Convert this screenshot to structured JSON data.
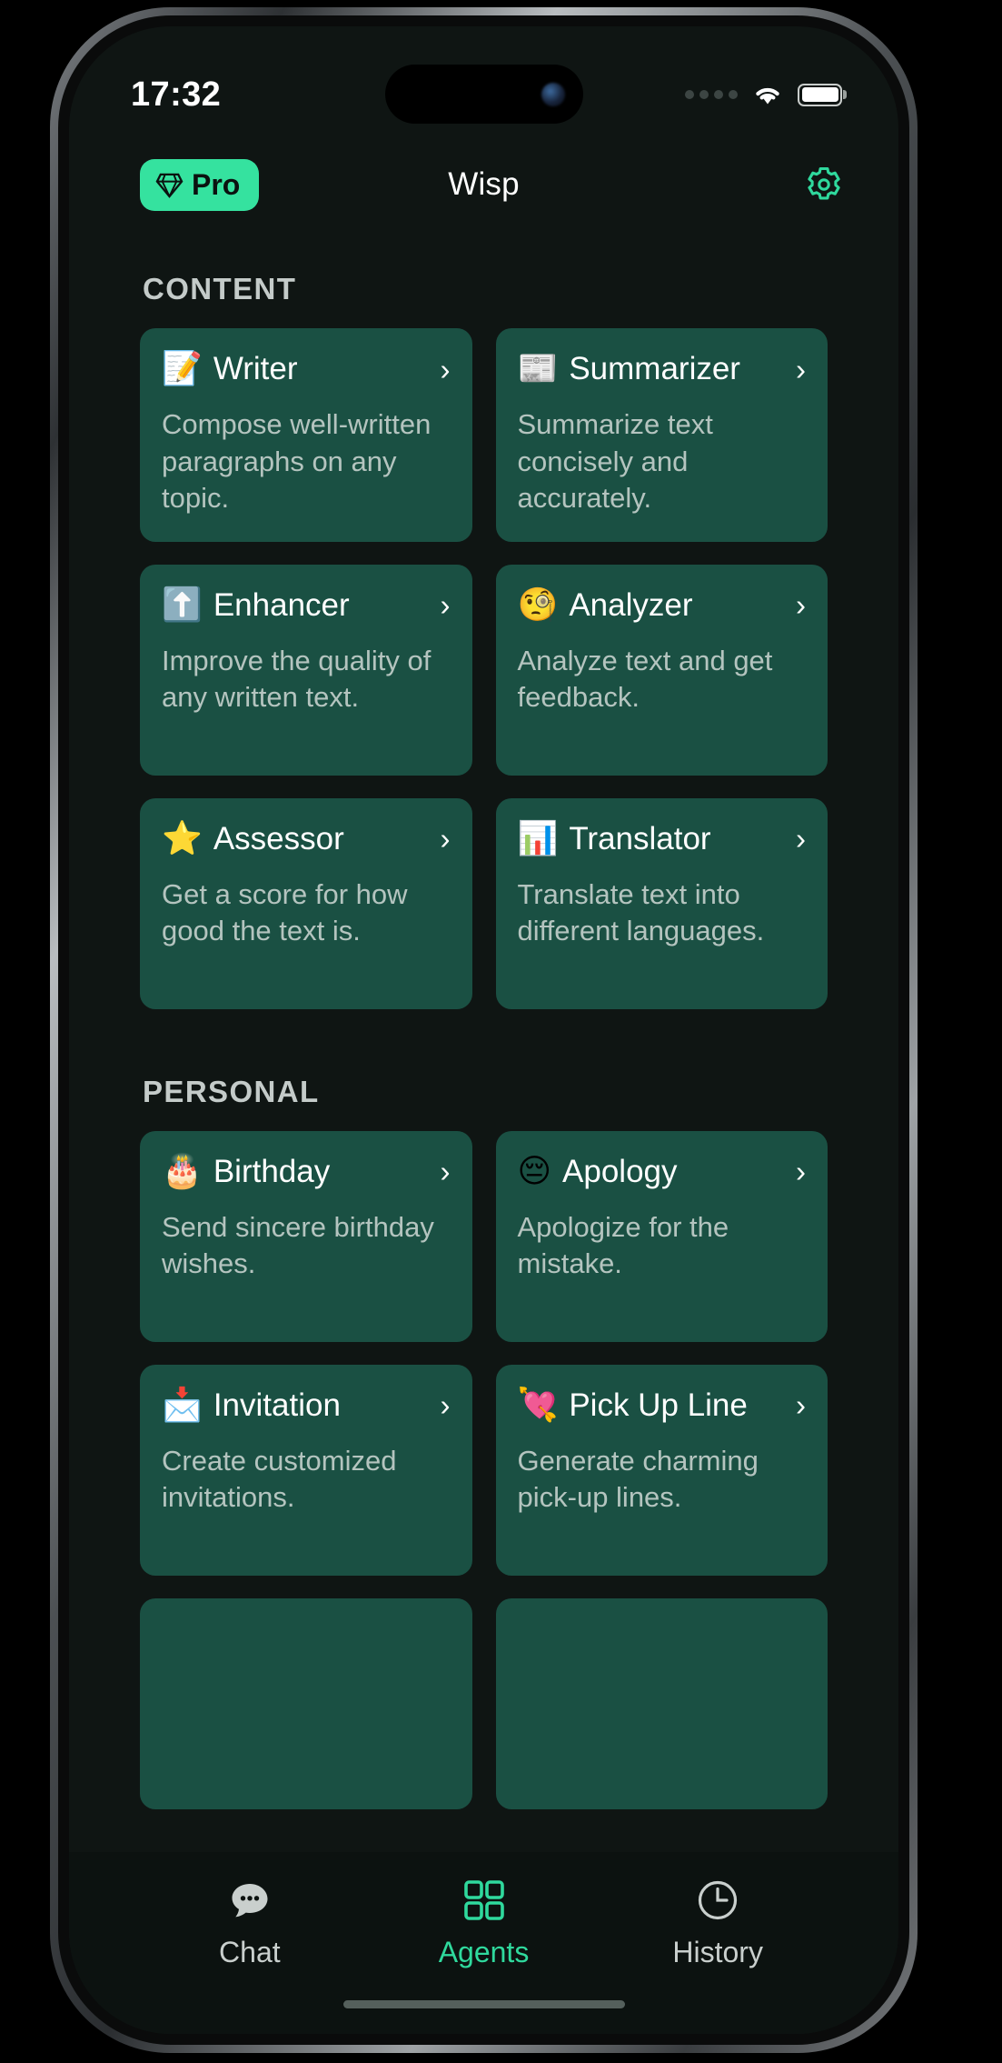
{
  "statusbar": {
    "time": "17:32",
    "signal_icon": "signal-dots-icon",
    "wifi_icon": "wifi-icon",
    "battery_icon": "battery-full-icon"
  },
  "header": {
    "pro_label": "Pro",
    "pro_icon": "diamond-icon",
    "title": "Wisp",
    "settings_icon": "gear-icon",
    "accent_color": "#35e29f"
  },
  "theme": {
    "background": "#0f1513",
    "card_background": "#1a5043",
    "accent": "#2fd99d",
    "title_text": "#ffffff",
    "desc_text": "#b4c4bf",
    "section_text": "#c4cbc9"
  },
  "sections": [
    {
      "label": "CONTENT",
      "cards": [
        {
          "emoji": "📝",
          "icon_name": "memo-icon",
          "title": "Writer",
          "desc": "Compose well-written paragraphs on any topic.",
          "chevron": "›"
        },
        {
          "emoji": "📰",
          "icon_name": "newspaper-icon",
          "title": "Summarizer",
          "desc": "Summarize text concisely and accurately.",
          "chevron": "›"
        },
        {
          "emoji": "⬆️",
          "icon_name": "up-arrow-icon",
          "title": "Enhancer",
          "desc": "Improve the quality of any written text.",
          "chevron": "›"
        },
        {
          "emoji": "🧐",
          "icon_name": "monocle-face-icon",
          "title": "Analyzer",
          "desc": "Analyze text and get feedback.",
          "chevron": "›"
        },
        {
          "emoji": "⭐",
          "icon_name": "star-icon",
          "title": "Assessor",
          "desc": "Get a score for how good the text is.",
          "chevron": "›"
        },
        {
          "emoji": "📊",
          "icon_name": "bar-chart-icon",
          "title": "Translator",
          "desc": "Translate text into different languages.",
          "chevron": "›"
        }
      ]
    },
    {
      "label": "PERSONAL",
      "cards": [
        {
          "emoji": "🎂",
          "icon_name": "birthday-cake-icon",
          "title": "Birthday",
          "desc": "Send sincere birthday wishes.",
          "chevron": "›"
        },
        {
          "emoji": "😔",
          "icon_name": "pensive-face-icon",
          "title": "Apology",
          "desc": "Apologize for the mistake.",
          "chevron": "›"
        },
        {
          "emoji": "📩",
          "icon_name": "envelope-icon",
          "title": "Invitation",
          "desc": "Create customized invitations.",
          "chevron": "›"
        },
        {
          "emoji": "💘",
          "icon_name": "heart-arrow-icon",
          "title": "Pick Up Line",
          "desc": "Generate charming pick-up lines.",
          "chevron": "›"
        }
      ]
    }
  ],
  "tabbar": {
    "tabs": [
      {
        "label": "Chat",
        "icon_name": "chat-bubble-icon",
        "active": false
      },
      {
        "label": "Agents",
        "icon_name": "grid-icon",
        "active": true
      },
      {
        "label": "History",
        "icon_name": "clock-icon",
        "active": false
      }
    ]
  }
}
